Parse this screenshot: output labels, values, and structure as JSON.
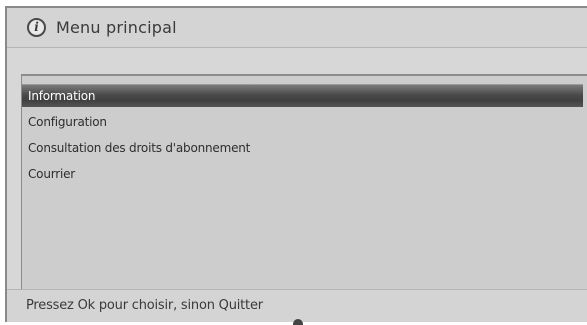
{
  "header": {
    "icon": "info-icon",
    "icon_glyph": "i",
    "title": "Menu principal"
  },
  "menu": {
    "items": [
      {
        "label": "Information",
        "selected": true
      },
      {
        "label": "Configuration",
        "selected": false
      },
      {
        "label": "Consultation des droits d'abonnement",
        "selected": false
      },
      {
        "label": "Courrier",
        "selected": false
      }
    ]
  },
  "footer": {
    "hint": "Pressez Ok pour choisir, sinon Quitter"
  },
  "colors": {
    "background": "#d7d7d7",
    "selected_background": "#4a4a4a",
    "selected_text": "#ffffff",
    "text": "#3a3a3a"
  }
}
